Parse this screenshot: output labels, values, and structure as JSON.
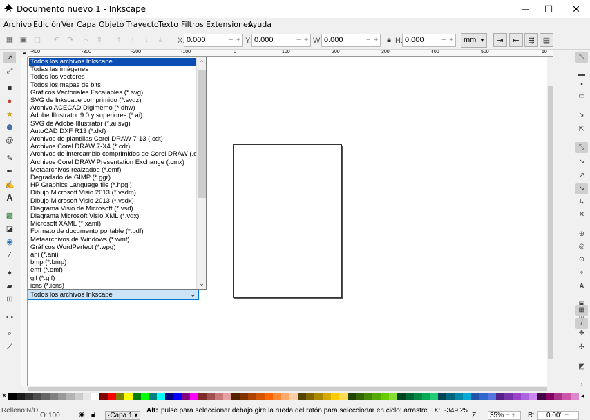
{
  "window": {
    "title": "Documento nuevo 1 - Inkscape",
    "minimize_label": "─",
    "maximize_label": "☐",
    "close_label": "✕"
  },
  "menu": [
    "Archivo",
    "Edición",
    "Ver",
    "Capa",
    "Objeto",
    "Trayecto",
    "Texto",
    "Filtros",
    "Extensiones",
    "Ayuda"
  ],
  "toolbar": {
    "x_label": "X:",
    "x_value": "0.000",
    "y_label": "Y:",
    "y_value": "0.000",
    "w_label": "W:",
    "w_value": "0.000",
    "h_label": "H:",
    "h_value": "0.000",
    "unit": "mm"
  },
  "ruler_top_labels": [
    "-400",
    "-300",
    "-200",
    "-100",
    "0",
    "100",
    "200",
    "300",
    "400",
    "500",
    "60"
  ],
  "file_type_list": {
    "selected_index": 0,
    "items": [
      "Todos los archivos Inkscape",
      "Todas las imágenes",
      "Todos los vectores",
      "Todos los mapas de bits",
      "Gráficos Vectoriales Escalables (*.svg)",
      "SVG de Inkscape comprimido (*.svgz)",
      "Archivo ACECAD Digimemo (*.dhw)",
      "Adobe Illustrator 9.0 y superiores (*.ai)",
      "SVG de Adobe Illustrator (*.ai.svg)",
      "AutoCAD DXF R13 (*.dxf)",
      "Archivos de plantillas Corel DRAW 7-13 (.cdt)",
      "Archivos Corel DRAW 7-X4 (*.cdr)",
      "Archivos de intercambio comprimidos de Corel DRAW (.ccx)",
      "Archivos Corel DRAW Presentation Exchange (.cmx)",
      "Metaarchivos realzados (*.emf)",
      "Degradado de GIMP (*.ggr)",
      "HP Graphics Language file (*.hpgl)",
      "Dibujo Microsoft Visio 2013 (*.vsdm)",
      "Dibujo Microsoft Visio 2013 (*.vsdx)",
      "Diagrama Visio de Microsoft (*.vsd)",
      "Diagrama Microsoft Visio XML (*.vdx)",
      "Microsoft XAML (*.xaml)",
      "Formato de documento portable (*.pdf)",
      "Metaarchivos de Windows (*.wmf)",
      "Gráficos WordPerfect (*.wpg)",
      "ani (*.ani)",
      "bmp (*.bmp)",
      "emf (*.emf)",
      "gif (*.gif)",
      "icns (*.icns)"
    ]
  },
  "combo_value": "Todos los archivos Inkscape",
  "status": {
    "fill_label": "Relleno:",
    "fill_value": "N/D",
    "opacity_label": "O:",
    "opacity_value": "100",
    "layer": "·Capa 1",
    "message_bold": "Alt:",
    "message": "pulse para seleccionar debajo,gire la rueda del ratón para seleccionar en ciclo; arrastre",
    "x_label": "X:",
    "x_value": "-349.25",
    "zoom_label": "Z:",
    "zoom_value": "35%",
    "rotation_label": "R:",
    "rotation_value": "0.00°"
  },
  "palette_colors": [
    "#000000",
    "#1a1a1a",
    "#333333",
    "#4d4d4d",
    "#666666",
    "#808080",
    "#999999",
    "#b3b3b3",
    "#cccccc",
    "#e6e6e6",
    "#ffffff",
    "#800000",
    "#ff0000",
    "#808000",
    "#ffff00",
    "#008000",
    "#00ff00",
    "#008080",
    "#00ffff",
    "#000080",
    "#0000ff",
    "#800080",
    "#ff00ff",
    "#7f2a2a",
    "#a05050",
    "#c87878",
    "#e6a0a0",
    "#552200",
    "#803300",
    "#aa4400",
    "#d45500",
    "#ff6600",
    "#ff8833",
    "#ffaa66",
    "#ffccaa",
    "#554400",
    "#806600",
    "#aa8800",
    "#d4aa00",
    "#ffcc00",
    "#ffdd55",
    "#224400",
    "#336600",
    "#448800",
    "#55aa00",
    "#66cc00",
    "#88dd33",
    "#004422",
    "#006633",
    "#008844",
    "#00aa55",
    "#22cc77",
    "#004455",
    "#006680",
    "#0088aa",
    "#00aad4",
    "#2255aa",
    "#3366cc",
    "#5577dd",
    "#552288",
    "#7733aa",
    "#9944cc",
    "#aa66dd",
    "#cc88ee",
    "#440044",
    "#880066",
    "#aa3388",
    "#cc55aa",
    "#dd88cc"
  ]
}
